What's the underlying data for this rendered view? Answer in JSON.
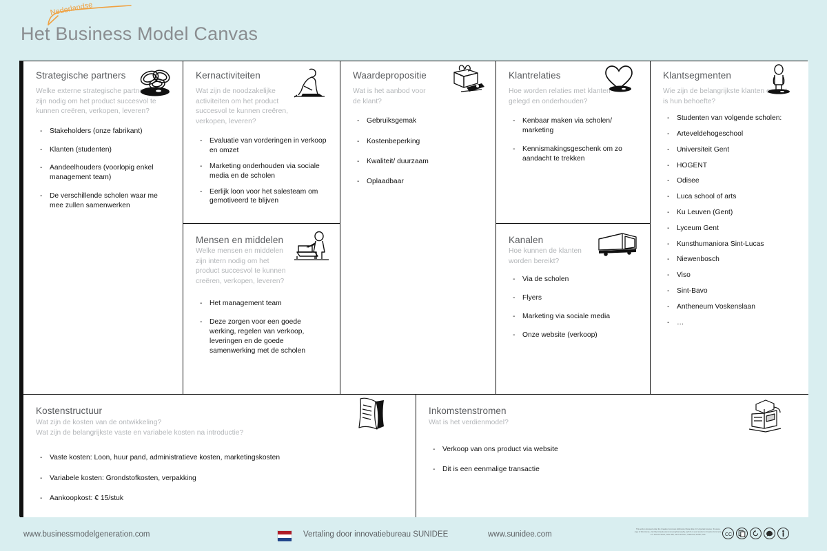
{
  "header": {
    "badge_label": "Nederlandse",
    "title": "Het Business Model Canvas",
    "title_color": "#8a8d90",
    "badge_color": "#f0a140",
    "background_color": "#d9eef0"
  },
  "blocks": {
    "partners": {
      "title": "Strategische partners",
      "icon": "chain-links-icon",
      "question": "Welke externe strategische partners zijn nodig om het product succesvol te kunnen creëren, verkopen, leveren?",
      "items": [
        "Stakeholders (onze fabrikant)",
        "Klanten (studenten)",
        "Aandeelhouders (voorlopig enkel management team)",
        "De verschillende scholen waar me mee zullen samenwerken"
      ]
    },
    "activities": {
      "title": "Kernactiviteiten",
      "icon": "worker-pushing-icon",
      "question": "Wat zijn de noodzakelijke activiteiten om het product succesvol te kunnen creëren, verkopen,  leveren?",
      "items": [
        "Evaluatie van vorderingen in verkoop en omzet",
        "Marketing onderhouden via sociale media en de scholen",
        "Eerlijk loon voor het salesteam om gemotiveerd te blijven"
      ]
    },
    "resources": {
      "title": "Mensen en middelen",
      "icon": "worker-pallet-icon",
      "question": "Welke mensen en middelen zijn intern nodig om het product succesvol te kunnen creëren, verkopen, leveren?",
      "items": [
        "Het management team",
        "Deze zorgen voor een goede werking, regelen van verkoop, leveringen en de goede samenwerking met de scholen"
      ]
    },
    "value": {
      "title": "Waardepropositie",
      "icon": "gift-box-icon",
      "question": "Wat is het aanbod voor de klant?",
      "items": [
        "Gebruiksgemak",
        "Kostenbeperking",
        "Kwaliteit/ duurzaam",
        "Oplaadbaar"
      ]
    },
    "relations": {
      "title": "Klantrelaties",
      "icon": "heart-icon",
      "question": "Hoe worden relaties met klanten gelegd en onderhouden?",
      "items": [
        "Kenbaar maken via scholen/ marketing",
        "Kennismakingsgeschenk om zo aandacht te trekken"
      ]
    },
    "channels": {
      "title": "Kanalen",
      "icon": "delivery-truck-icon",
      "question": "Hoe kunnen de klanten worden bereikt?",
      "items": [
        "Via de scholen",
        "Flyers",
        "Marketing via sociale media",
        "Onze website (verkoop)"
      ]
    },
    "segments": {
      "title": "Klantsegmenten",
      "icon": "standing-person-icon",
      "question": "Wie zijn de belangrijkste klanten en wat is hun behoefte?",
      "items": [
        "Studenten van volgende scholen:",
        "Arteveldehogeschool",
        "Universiteit Gent",
        "HOGENT",
        "Odisee",
        "Luca school of arts",
        "Ku Leuven (Gent)",
        "Lyceum Gent",
        "Kunsthumaniora Sint-Lucas",
        "Niewenbosch",
        "Viso",
        "Sint-Bavo",
        "Antheneum Voskenslaan",
        "…"
      ]
    },
    "costs": {
      "title": "Kostenstructuur",
      "icon": "invoice-paper-icon",
      "question_line1": "Wat zijn de kosten van de ontwikkeling?",
      "question_line2": "Wat zijn de belangrijkste vaste en variabele kosten na introductie?",
      "items": [
        "Vaste kosten: Loon, huur pand, administratieve kosten, marketingskosten",
        "Variabele kosten: Grondstofkosten, verpakking",
        "Aankoopkost: € 15/stuk"
      ]
    },
    "revenue": {
      "title": "Inkomstenstromen",
      "icon": "cash-register-icon",
      "question": "Wat is het verdienmodel?",
      "items": [
        "Verkoop van ons product via website",
        "Dit is een eenmalige transactie"
      ]
    }
  },
  "footer": {
    "bmg_url": "www.businessmodelgeneration.com",
    "flag_icon": "netherlands-flag-icon",
    "translation_credit": "Vertaling door  innovatiebureau SUNIDEE",
    "sunidee_url": "www.sunidee.com",
    "license_text": "This work is licensed under the Creative Commons Attribution-Share Alike 3.0 Unported License. To view a copy of this license, visit http://creativecommons.org/licenses/by-sa/3.0/ or send a letter to Creative Commons, 171 Second Street, Suite 300, San Francisco, California, 94105, USA.",
    "cc_badges": [
      "cc-icon",
      "copy-icon",
      "share-alike-icon",
      "attribution-bubble-icon",
      "person-attribution-icon"
    ]
  }
}
